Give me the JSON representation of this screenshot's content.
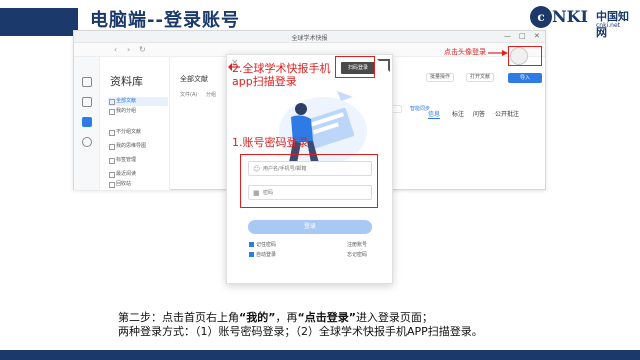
{
  "slide": {
    "title": "电脑端--登录账号",
    "logo": {
      "mark": "c",
      "name": "NKI",
      "cn": "中国知网",
      "url": "cnki.net"
    }
  },
  "app": {
    "window_title": "全球学术快报",
    "nav": {
      "back": "‹",
      "forward": "›",
      "refresh": "↻"
    },
    "window_controls": [
      "—",
      "□",
      "✕"
    ],
    "library": {
      "title": "资料库",
      "items": [
        "全部文献",
        "我的分组",
        "不分组文献",
        "我的思维导图",
        "标签管理",
        "最近阅读",
        "回收站"
      ]
    },
    "content": {
      "title": "全部文献",
      "sub_tabs": [
        "文件(A)",
        "分组"
      ],
      "toolbar": [
        "批量操作",
        "打开文献"
      ],
      "import_label": "导入",
      "right_tabs": [
        "信息",
        "标注",
        "问答",
        "公开批注"
      ],
      "right_link": "智能同步"
    }
  },
  "login": {
    "close": "×",
    "scan_button": "扫码登录",
    "username_placeholder": "用户名/手机号/邮箱",
    "password_placeholder": "密码",
    "login_button": "登录",
    "remember": "记住密码",
    "auto_login": "自动登录",
    "register": "注册账号",
    "forgot": "忘记密码"
  },
  "annotations": {
    "avatar_hint": "点击头像登录",
    "scan_hint": "2.全球学术快报手机app扫描登录",
    "account_hint": "1.账号密码登录"
  },
  "caption": {
    "line1_a": "第二步：点击首页右上角",
    "line1_b": "“我的”",
    "line1_c": "，再",
    "line1_d": "“点击登录”",
    "line1_e": "进入登录页面；",
    "line2": "两种登录方式：（1）账号密码登录；（2）全球学术快报手机APP扫描登录。"
  },
  "colors": {
    "brand": "#1b3a6b",
    "accent": "#2e7be6",
    "annotation": "#e02020"
  }
}
